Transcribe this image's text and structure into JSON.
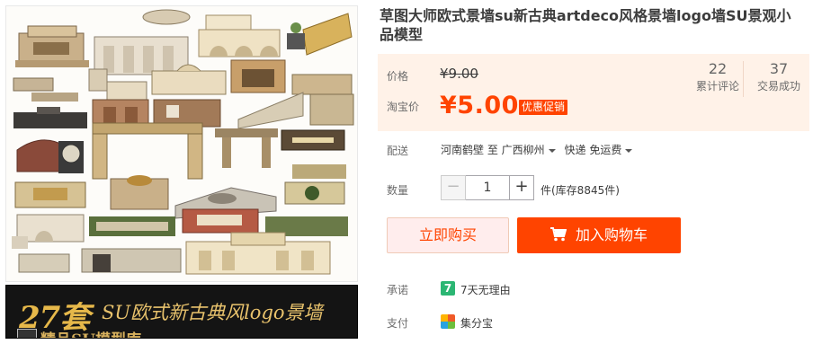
{
  "product": {
    "title": "草图大师欧式景墙su新古典artdeco风格景墙logo墙SU景观小品模型"
  },
  "gallery": {
    "banner_number": "27套",
    "banner_text": "SU欧式新古典风logo景墙",
    "banner_sub": "精品SU模型库"
  },
  "price": {
    "label": "价格",
    "original": "¥9.00",
    "promo_label": "淘宝价",
    "promo": "¥5.00",
    "promo_tag": "优惠促销"
  },
  "stats": {
    "reviews_count": "22",
    "reviews_label": "累计评论",
    "deals_count": "37",
    "deals_label": "交易成功"
  },
  "shipping": {
    "label": "配送",
    "from": "河南鹤壁 至",
    "to": "广西柳州",
    "method": "快递 免运费"
  },
  "quantity": {
    "label": "数量",
    "value": "1",
    "minus": "−",
    "plus": "+",
    "stock": "件(库存8845件)"
  },
  "actions": {
    "buy_now": "立即购买",
    "add_to_cart": "加入购物车"
  },
  "promises": {
    "label": "承诺",
    "item": "7天无理由",
    "item_icon_text": "7"
  },
  "payment": {
    "label": "支付",
    "item": "集分宝"
  },
  "colors": {
    "accent": "#ff4400",
    "panel_bg": "#fff2e8"
  }
}
